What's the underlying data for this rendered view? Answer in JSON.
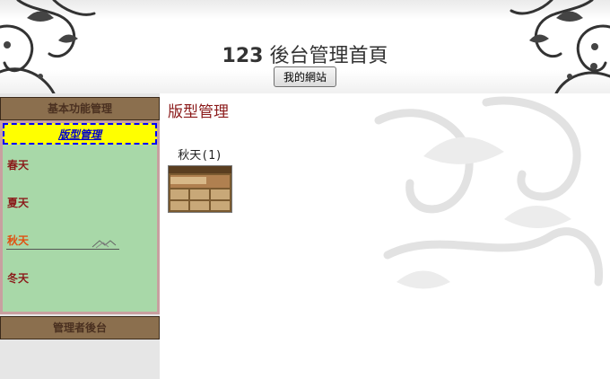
{
  "header": {
    "site_number": "123",
    "site_title": "後台管理首頁",
    "my_site_button": "我的網站"
  },
  "sidebar": {
    "panels": [
      {
        "title": "基本功能管理",
        "active_item": "版型管理",
        "items": [
          {
            "label": "春天"
          },
          {
            "label": "夏天"
          },
          {
            "label": "秋天",
            "active": true
          },
          {
            "label": "冬天"
          }
        ]
      },
      {
        "title": "管理者後台"
      }
    ]
  },
  "main": {
    "title": "版型管理",
    "themes": [
      {
        "name": "秋天(1)",
        "thumbnail_icon": "autumn-theme-preview"
      }
    ]
  },
  "colors": {
    "panel_header_bg": "#8b6f4e",
    "panel_body_bg": "#a8d8a8",
    "active_item_bg": "#ffff00",
    "active_item_text": "#0000cc",
    "season_text": "#8b1a1a",
    "season_active_text": "#e05010",
    "page_title": "#8b1a1a"
  }
}
